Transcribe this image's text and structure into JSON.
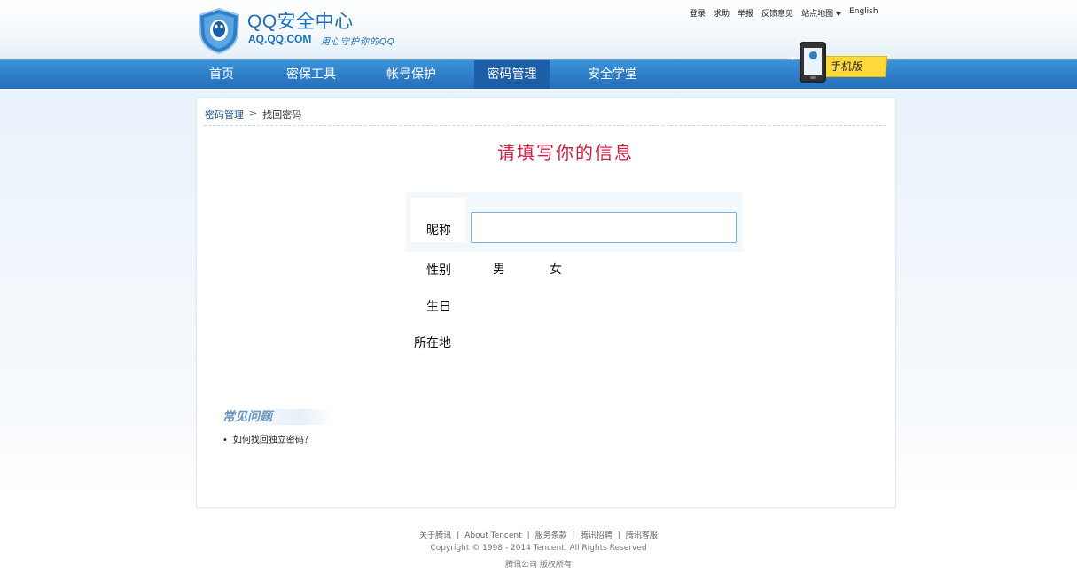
{
  "header": {
    "brand_title": "QQ安全中心",
    "brand_url": "AQ.QQ.COM",
    "brand_slogan": "用心守护你的QQ",
    "top_links": [
      "登录",
      "求助",
      "举报",
      "反馈意见",
      "站点地图",
      "English"
    ]
  },
  "nav": {
    "items": [
      {
        "label": "首页"
      },
      {
        "label": "密保工具"
      },
      {
        "label": "帐号保护"
      },
      {
        "label": "密码管理"
      },
      {
        "label": "安全学堂"
      }
    ],
    "active": "密码管理",
    "mobile_label": "手机版"
  },
  "breadcrumb": {
    "parent": "密码管理",
    "separator": ">",
    "current": "找回密码"
  },
  "form": {
    "heading": "请填写你的信息",
    "nickname_label": "昵称",
    "nickname_value": "",
    "gender_label": "性别",
    "gender_options": [
      "男",
      "女"
    ],
    "birthday_label": "生日",
    "location_label": "所在地"
  },
  "faq": {
    "title": "常见问题",
    "items": [
      "如何找回独立密码？"
    ]
  },
  "footer": {
    "links": [
      "关于腾讯",
      "About Tencent",
      "服务条款",
      "腾讯招聘",
      "腾讯客服"
    ],
    "copyright": "Copyright © 1998 - 2014 Tencent. All Rights Reserved",
    "owner": "腾讯公司 版权所有"
  },
  "colors": {
    "nav_bg": "#2f7fc8",
    "nav_active": "#1d5ea6",
    "heading": "#d81e3f",
    "brand": "#1a6fc0",
    "mobile_badge": "#ffd83a"
  },
  "icons": {
    "logo": "qq-shield-logo-icon",
    "dropdown": "caret-down-icon",
    "phone": "mobile-phone-icon"
  }
}
